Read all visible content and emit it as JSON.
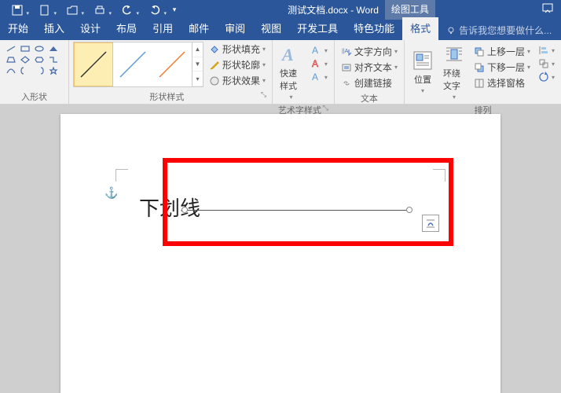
{
  "title_bar": {
    "doc_title": "测试文档.docx - Word",
    "tool_tab": "绘图工具",
    "qat": [
      "save",
      "new",
      "open",
      "print",
      "undo",
      "redo",
      "more"
    ]
  },
  "tabs": {
    "items": [
      {
        "label": "开始"
      },
      {
        "label": "插入"
      },
      {
        "label": "设计"
      },
      {
        "label": "布局"
      },
      {
        "label": "引用"
      },
      {
        "label": "邮件"
      },
      {
        "label": "审阅"
      },
      {
        "label": "视图"
      },
      {
        "label": "开发工具"
      },
      {
        "label": "特色功能"
      },
      {
        "label": "格式"
      }
    ],
    "active_index": 10,
    "tell_me": "告诉我您想要做什么..."
  },
  "ribbon": {
    "insert_shapes": {
      "label": "入形状"
    },
    "shape_styles": {
      "label": "形状样式",
      "fill": "形状填充",
      "outline": "形状轮廓",
      "effects": "形状效果"
    },
    "wordart_styles": {
      "label": "艺术字样式",
      "quick": "快速样式"
    },
    "text": {
      "label": "文本",
      "direction": "文字方向",
      "align": "对齐文本",
      "link": "创建链接"
    },
    "arrange": {
      "label": "排列",
      "position": "位置",
      "wrap": "环绕文字",
      "forward": "上移一层",
      "backward": "下移一层",
      "selection": "选择窗格"
    }
  },
  "document": {
    "text": "下划线"
  }
}
